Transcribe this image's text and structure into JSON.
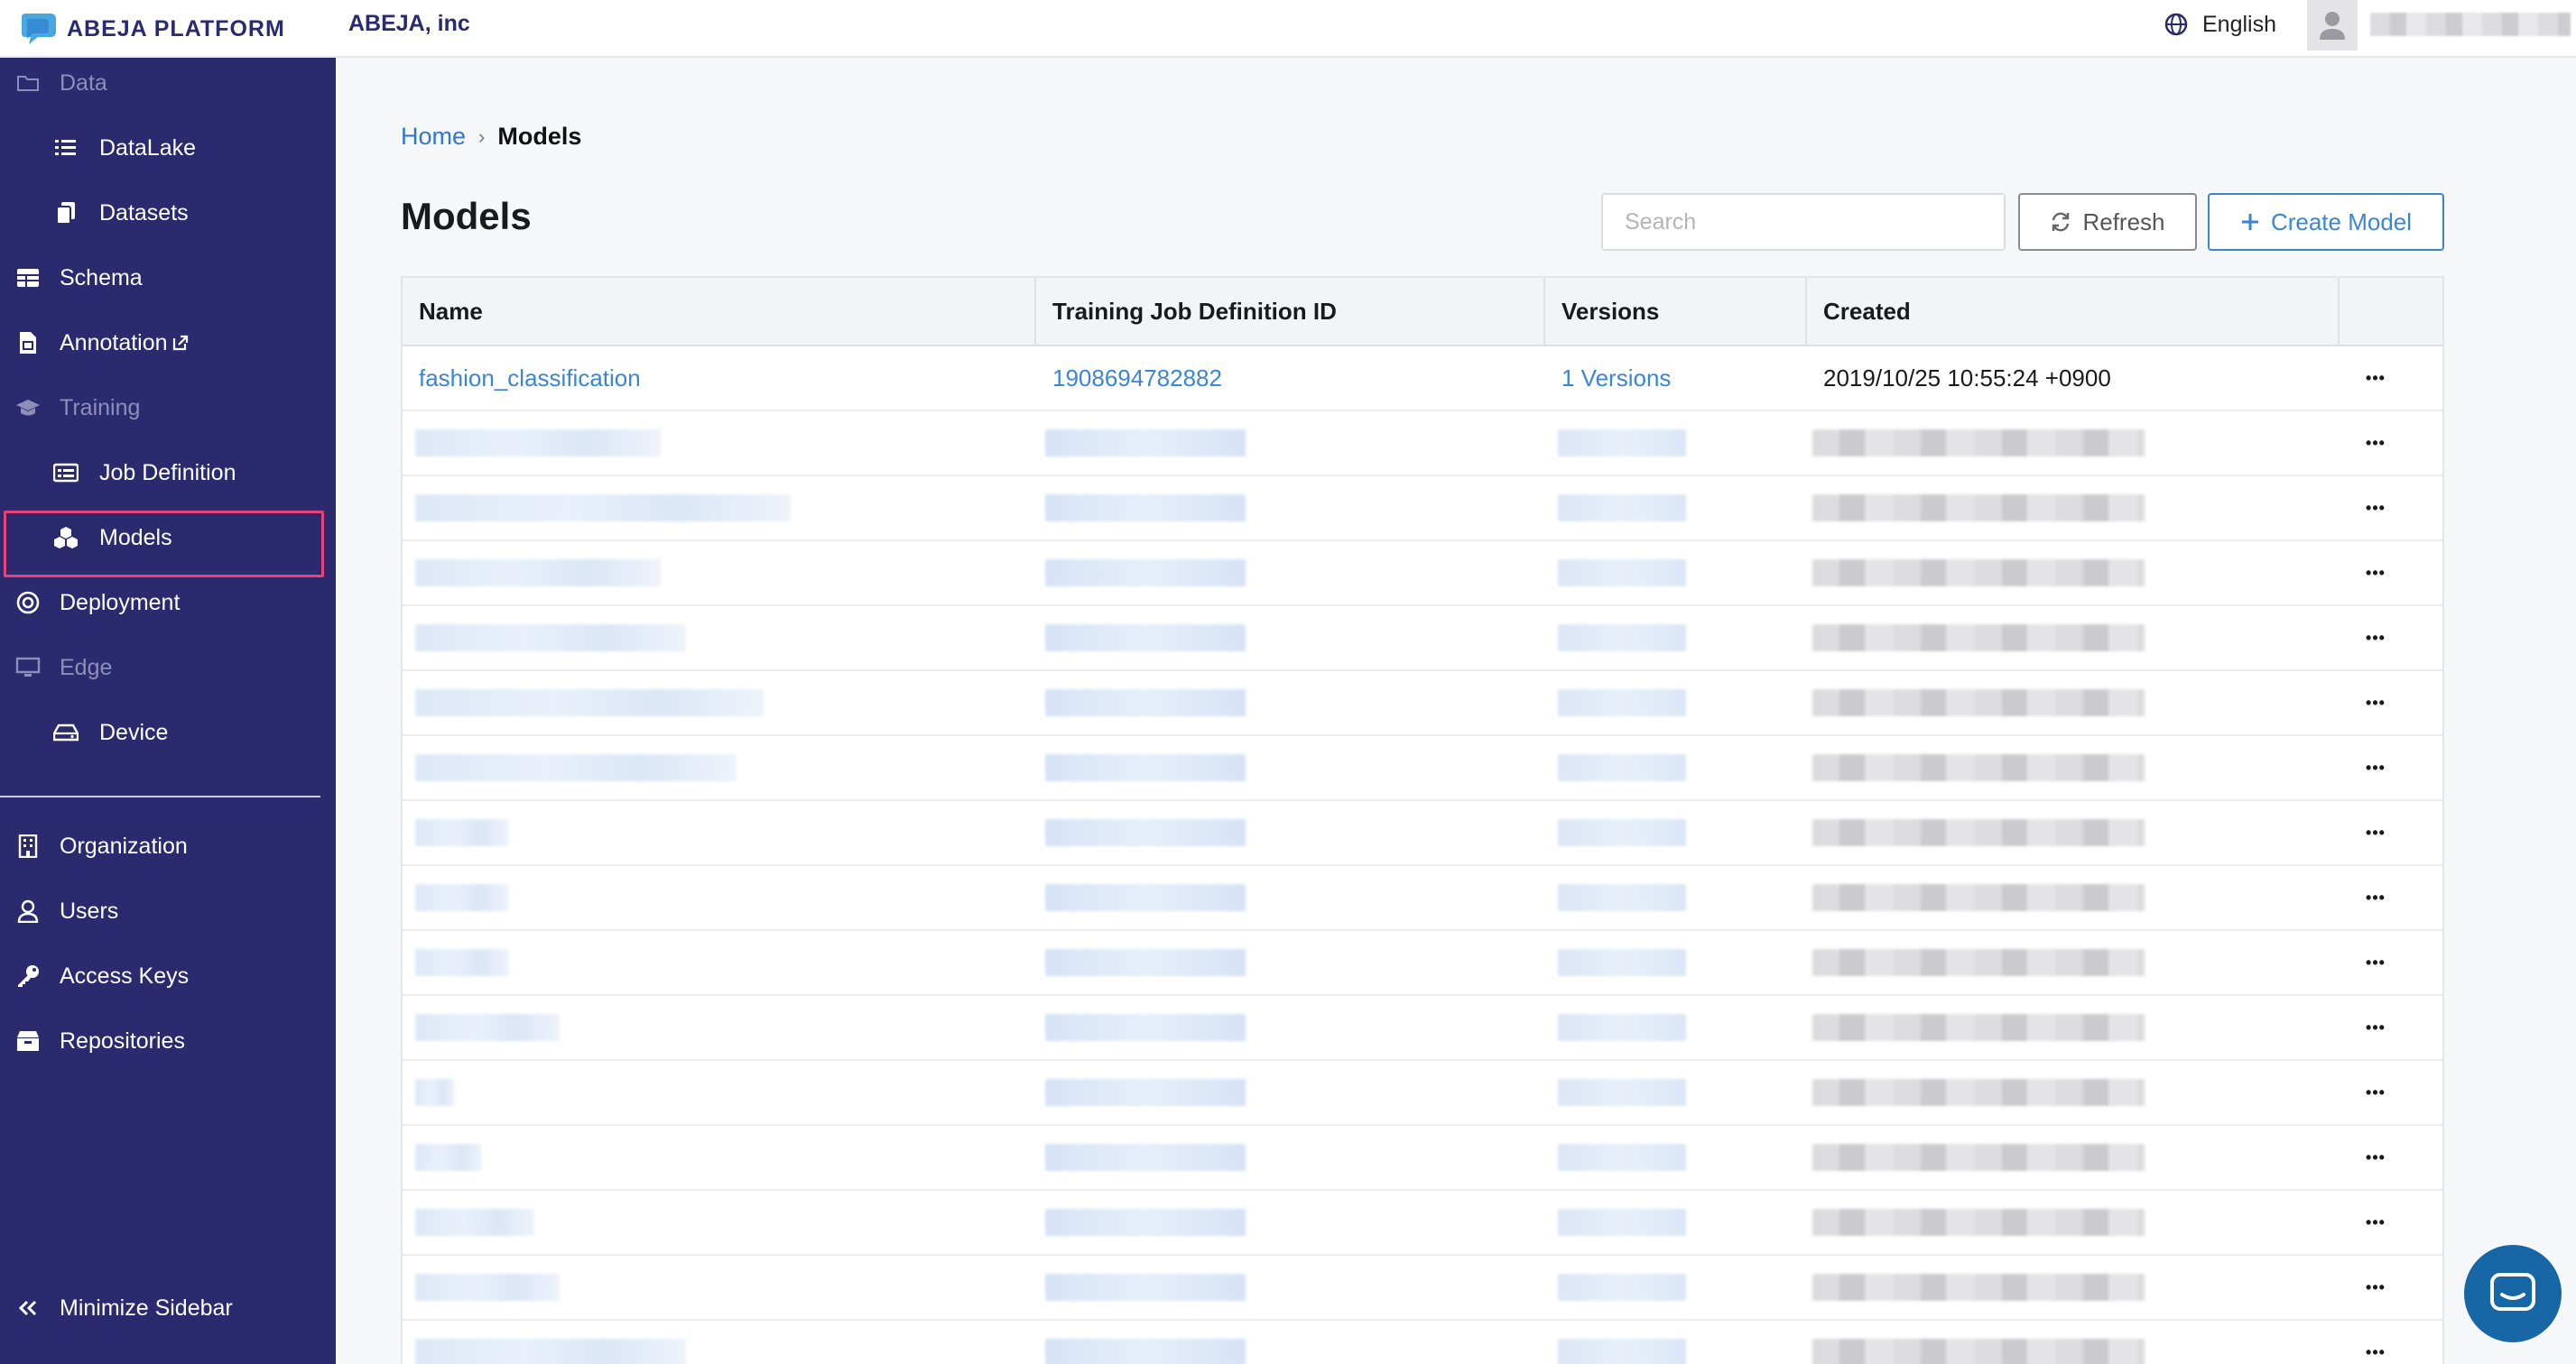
{
  "brand": {
    "name": "ABEJA PLATFORM",
    "logo_icon": "abeja-logo-icon"
  },
  "header": {
    "org": "ABEJA, inc",
    "language": "English",
    "user_name": ""
  },
  "sidebar": {
    "data_section": "Data",
    "datalake": "DataLake",
    "datasets": "Datasets",
    "schema": "Schema",
    "annotation": "Annotation",
    "training_section": "Training",
    "job_definition": "Job Definition",
    "models": "Models",
    "deployment": "Deployment",
    "edge_section": "Edge",
    "device": "Device",
    "organization": "Organization",
    "users": "Users",
    "access_keys": "Access Keys",
    "repositories": "Repositories",
    "minimize": "Minimize Sidebar",
    "active_item": "Models"
  },
  "breadcrumb": {
    "home": "Home",
    "separator": "›",
    "current": "Models"
  },
  "page": {
    "title": "Models"
  },
  "toolbar": {
    "search_placeholder": "Search",
    "refresh": "Refresh",
    "create": "Create Model"
  },
  "table": {
    "columns": [
      "Name",
      "Training Job Definition ID",
      "Versions",
      "Created"
    ],
    "first_row": {
      "name": "fashion_classification",
      "job_definition_id": "1908694782882",
      "versions": "1 Versions",
      "created": "2019/10/25 10:55:24 +0900",
      "more": "•••"
    },
    "more_label": "•••",
    "redacted_row_count": 15
  },
  "colors": {
    "sidebar_bg": "#2b2a6f",
    "accent": "#3a86d4",
    "active_outline": "#e8407a"
  }
}
